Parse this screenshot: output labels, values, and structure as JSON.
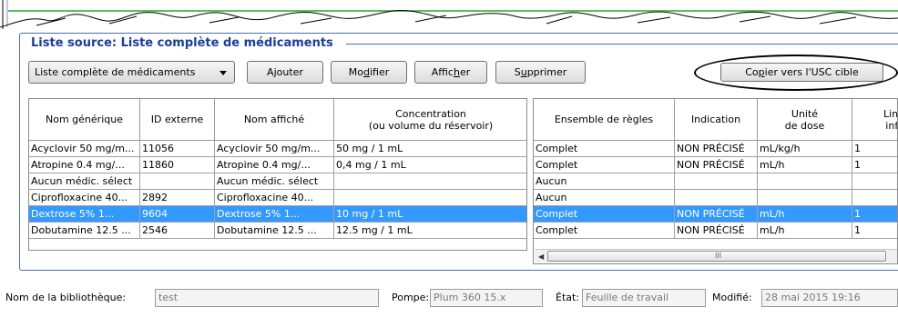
{
  "panel": {
    "title": "Liste source: Liste complète de médicaments"
  },
  "toolbar": {
    "list_dropdown_value": "Liste complète de médicaments",
    "add_label": "Ajouter",
    "edit_label_pre": "Mo",
    "edit_label_key": "d",
    "edit_label_post": "ifier",
    "view_label_pre": "Affic",
    "view_label_key": "h",
    "view_label_post": "er",
    "delete_label_pre": "S",
    "delete_label_key": "u",
    "delete_label_post": "pprimer",
    "copy_label_pre": "Co",
    "copy_label_key": "p",
    "copy_label_post": "ier vers l'USC cible"
  },
  "left_table": {
    "headers": [
      "Nom générique",
      "ID externe",
      "Nom affiché",
      "Concentration\n(ou volume du réservoir)"
    ],
    "rows": [
      [
        "Acyclovir 50 mg/m...",
        "11056",
        "Acyclovir 50 mg/m...",
        "50 mg / 1 mL"
      ],
      [
        "Atropine 0.4 mg/...",
        "11860",
        "Atropine 0.4 mg/...",
        "0,4 mg / 1 mL"
      ],
      [
        "Aucun médic. sélect",
        "",
        "Aucun médic. sélect",
        ""
      ],
      [
        "Ciprofloxacine 40...",
        "2892",
        "Ciprofloxacine 40...",
        ""
      ],
      [
        "Dextrose  5%  1...",
        "9604",
        "Dextrose  5%  1...",
        "10 mg / 1 mL"
      ],
      [
        "Dobutamine 12.5 ...",
        "2546",
        "Dobutamine 12.5 ...",
        "12.5 mg / 1 mL"
      ]
    ],
    "selected_row": 4
  },
  "right_table": {
    "headers": [
      "Ensemble de règles",
      "Indication",
      "Unité\nde dose",
      "Limi\ninfr"
    ],
    "rows": [
      [
        "Complet",
        "NON PRÉCISÉ",
        "mL/kg/h",
        "1"
      ],
      [
        "Complet",
        "NON PRÉCISÉ",
        "mL/h",
        "1"
      ],
      [
        "Aucun",
        "",
        "",
        ""
      ],
      [
        "Aucun",
        "",
        "",
        ""
      ],
      [
        "Complet",
        "NON PRÉCISÉ",
        "mL/h",
        "1"
      ],
      [
        "Complet",
        "NON PRÉCISÉ",
        "mL/h",
        "1"
      ]
    ],
    "selected_row": 4,
    "scroll_grip": "III"
  },
  "status": {
    "library_label": "Nom de la bibliothèque:",
    "library_value": "test",
    "pump_label": "Pompe:",
    "pump_value": "Plum 360 15.x",
    "state_label": "État:",
    "state_value": "Feuille de travail",
    "modified_label": "Modifié:",
    "modified_value": "28 mai 2015 19:16"
  }
}
